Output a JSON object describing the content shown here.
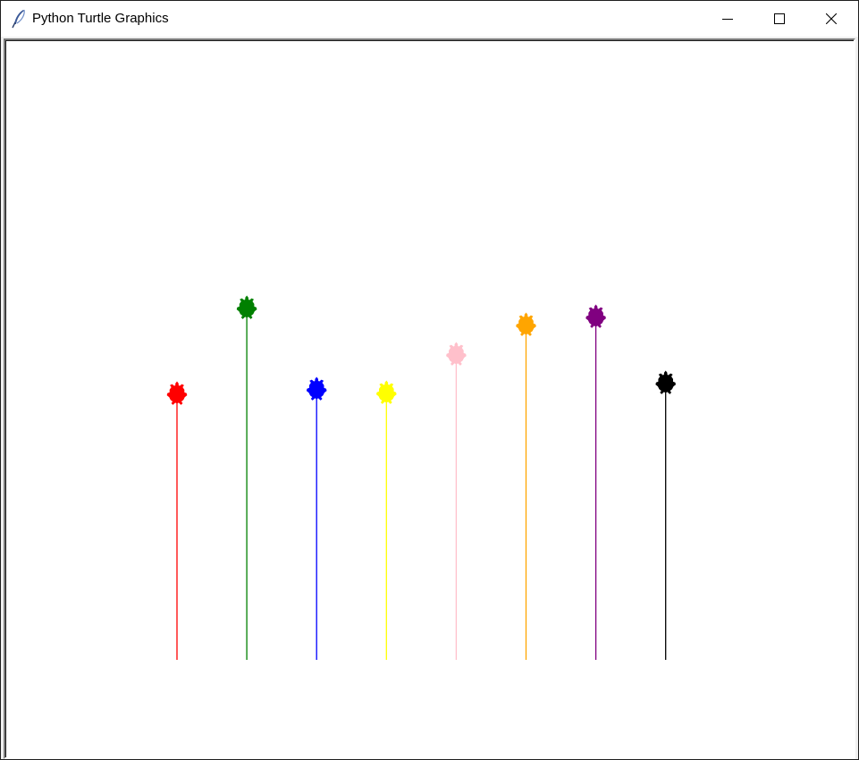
{
  "window": {
    "title": "Python Turtle Graphics",
    "icon": "feather-icon"
  },
  "controls": {
    "minimize_icon": "minimize-icon",
    "maximize_icon": "maximize-icon",
    "close_icon": "close-icon"
  },
  "turtles": [
    {
      "color": "#ff0000",
      "line_color": "#ff0000",
      "distance": 297
    },
    {
      "color": "#008000",
      "line_color": "#008000",
      "distance": 393
    },
    {
      "color": "#0000ff",
      "line_color": "#0000ff",
      "distance": 302
    },
    {
      "color": "#ffff00",
      "line_color": "#ffff00",
      "distance": 298
    },
    {
      "color": "#ffc0cb",
      "line_color": "#ffc0cb",
      "distance": 341
    },
    {
      "color": "#ffa500",
      "line_color": "#ffa500",
      "distance": 374
    },
    {
      "color": "#800080",
      "line_color": "#800080",
      "distance": 383
    },
    {
      "color": "#000000",
      "line_color": "#000000",
      "distance": 309
    }
  ]
}
